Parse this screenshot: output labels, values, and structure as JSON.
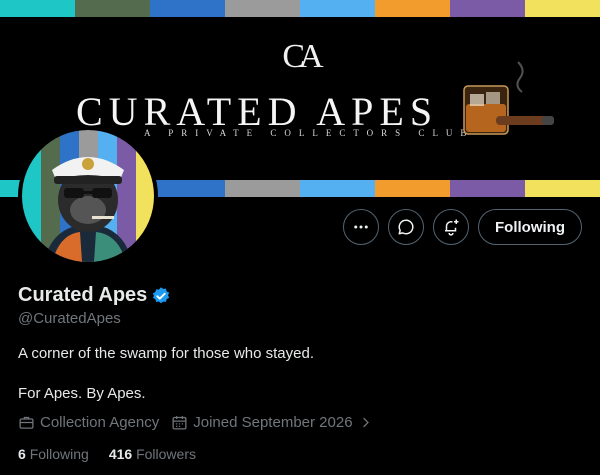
{
  "banner": {
    "logo_mark": "CA",
    "title": "CURATED APES",
    "subtitle": "A PRIVATE COLLECTORS CLUB",
    "stripe_colors": [
      "#1ec6c6",
      "#556b4e",
      "#2f73c9",
      "#9b9b9b",
      "#54b0f0",
      "#f39c2e",
      "#7b5aa6",
      "#f2e15c"
    ]
  },
  "actions": {
    "more_icon": "more-icon",
    "message_icon": "message-icon",
    "notify_icon": "bell-plus-icon",
    "following_label": "Following"
  },
  "profile": {
    "display_name": "Curated Apes",
    "verified": true,
    "verified_color": "#1d9bf0",
    "handle": "@CuratedApes",
    "bio_line1": "A corner of the swamp for those who stayed.",
    "bio_line2": "For Apes. By Apes.",
    "category": "Collection Agency",
    "joined": "Joined September 2026"
  },
  "stats": {
    "following_count": "6",
    "following_label": "Following",
    "followers_count": "416",
    "followers_label": "Followers"
  }
}
